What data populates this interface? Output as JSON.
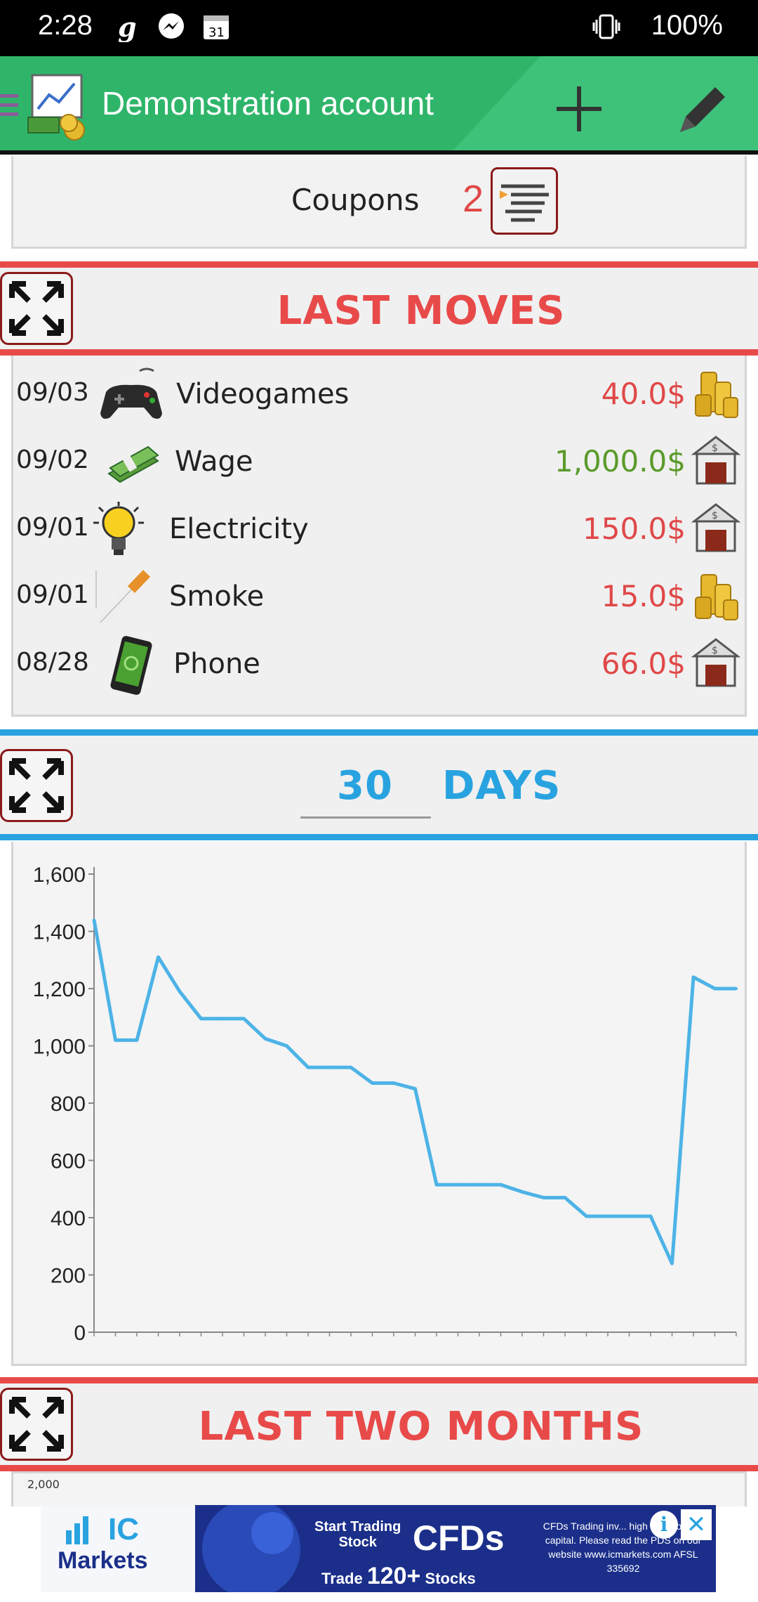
{
  "status_bar": {
    "time": "2:28",
    "battery": "100%"
  },
  "app_bar": {
    "title": "Demonstration account"
  },
  "coupons": {
    "label": "Coupons",
    "count": "2"
  },
  "sections": {
    "last_moves": "LAST MOVES",
    "days_value": "30",
    "days_label": "DAYS",
    "last_two_months": "LAST TWO MONTHS"
  },
  "moves": [
    {
      "date": "09/03",
      "category": "Videogames",
      "category_icon": "gamepad-icon",
      "amount": "40.0$",
      "type": "expense",
      "source_icon": "coins-icon"
    },
    {
      "date": "09/02",
      "category": "Wage",
      "category_icon": "money-icon",
      "amount": "1,000.0$",
      "type": "income",
      "source_icon": "bank-icon"
    },
    {
      "date": "09/01",
      "category": "Electricity",
      "category_icon": "lightbulb-icon",
      "amount": "150.0$",
      "type": "expense",
      "source_icon": "bank-icon"
    },
    {
      "date": "09/01",
      "category": "Smoke",
      "category_icon": "cigarette-icon",
      "amount": "15.0$",
      "type": "expense",
      "source_icon": "coins-icon"
    },
    {
      "date": "08/28",
      "category": "Phone",
      "category_icon": "phone-icon",
      "amount": "66.0$",
      "type": "expense",
      "source_icon": "bank-icon"
    }
  ],
  "colors": {
    "accent_green": "#2fb56a",
    "expense_red": "#e04848",
    "income_green": "#5a9a2a",
    "chart_blue": "#4db3e6",
    "section_red": "#e84a4a",
    "section_blue": "#29a3e0"
  },
  "chart_data": {
    "type": "line",
    "title": "",
    "xlabel": "",
    "ylabel": "",
    "ylim": [
      0,
      1600
    ],
    "yticks": [
      "0",
      "200",
      "400",
      "600",
      "800",
      "1,000",
      "1,200",
      "1,400",
      "1,600"
    ],
    "x_tick_count": 31,
    "series": [
      {
        "values": [
          1440,
          1020,
          1020,
          1310,
          1190,
          1095,
          1095,
          1095,
          1025,
          1000,
          925,
          925,
          925,
          870,
          870,
          850,
          515,
          515,
          515,
          515,
          490,
          470,
          470,
          405,
          405,
          405,
          405,
          240,
          1240,
          1200,
          1200
        ]
      }
    ],
    "grid": false
  },
  "partial_chart": {
    "first_tick": "2,000"
  },
  "ad": {
    "brand_top": "IC",
    "brand_bottom": "Markets",
    "start_trading": "Start Trading",
    "stock": "Stock",
    "cfds": "CFDs",
    "trade": "Trade",
    "stocks_count": "120+",
    "stocks_label": "Stocks",
    "disclaimer": "CFDs Trading inv... high risks to your capital. Please read the PDS on our website www.icmarkets.com AFSL 335692"
  }
}
